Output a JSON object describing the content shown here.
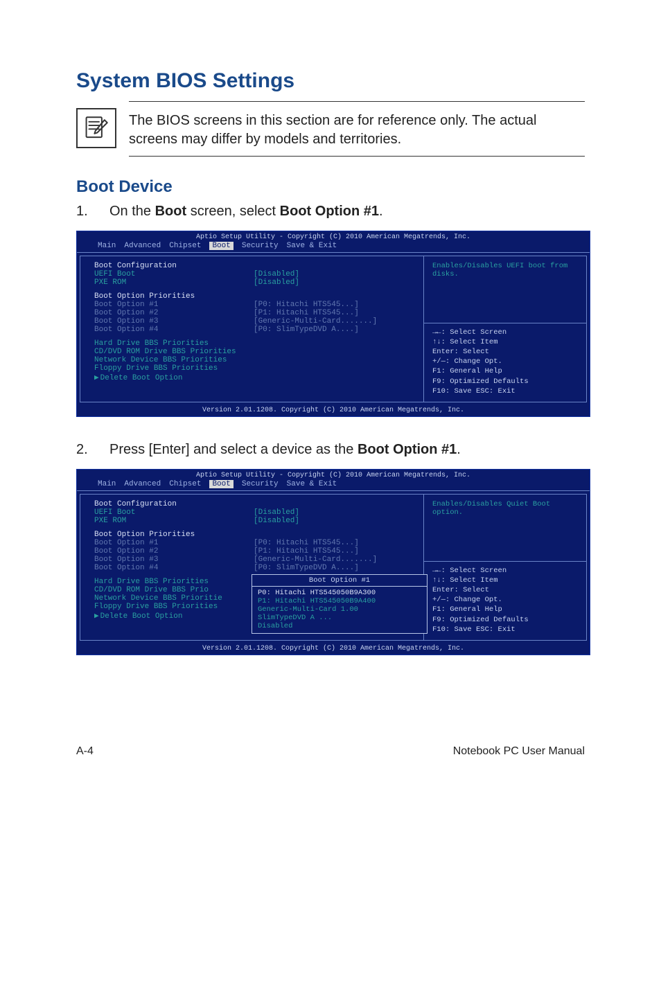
{
  "section_title": "System BIOS Settings",
  "note_text": "The BIOS screens in this section are for reference only. The actual screens may differ by models and territories.",
  "subsection_title": "Boot Device",
  "step1": {
    "num": "1.",
    "pre": "On the ",
    "b1": "Boot",
    "mid": " screen, select ",
    "b2": "Boot Option #1",
    "post": "."
  },
  "step2": {
    "num": "2.",
    "pre": "Press [Enter] and select a device as the ",
    "b1": "Boot Option #1",
    "post": "."
  },
  "bios_common": {
    "top": "Aptio Setup Utility - Copyright (C) 2010 American Megatrends, Inc.",
    "tabs": [
      "Main",
      "Advanced",
      "Chipset",
      "Boot",
      "Security",
      "Save & Exit"
    ],
    "footer": "Version 2.01.1208. Copyright (C) 2010 American Megatrends, Inc.",
    "keys": [
      "→←: Select Screen",
      "↑↓:   Select Item",
      "Enter: Select",
      "+/—:  Change Opt.",
      "F1:    General Help",
      "F9:    Optimized Defaults",
      "F10:  Save    ESC: Exit"
    ]
  },
  "bios1": {
    "help": "Enables/Disables UEFI boot from disks.",
    "boot_config_hdr": "Boot Configuration",
    "uefi_label": "UEFI Boot",
    "uefi_val": "[Disabled]",
    "pxe_label": "PXE ROM",
    "pxe_val": "[Disabled]",
    "prio_hdr": "Boot Option Priorities",
    "opts": [
      {
        "l": "Boot Option #1",
        "r": "[P0:  Hitachi HTS545...]"
      },
      {
        "l": "Boot Option #2",
        "r": "[P1:  Hitachi HTS545...]"
      },
      {
        "l": "Boot Option #3",
        "r": "[Generic-Multi-Card.......]"
      },
      {
        "l": "Boot Option #4",
        "r": "[P0:  SlimTypeDVD A....]"
      }
    ],
    "links": [
      "Hard Drive BBS Priorities",
      "CD/DVD ROM Drive BBS Priorities",
      "Network Device BBS Priorities",
      "Floppy Drive BBS Priorities",
      "Delete Boot Option"
    ]
  },
  "bios2": {
    "help": "Enables/Disables Quiet Boot option.",
    "boot_config_hdr": "Boot Configuration",
    "uefi_label": "UEFI Boot",
    "uefi_val": "[Disabled]",
    "pxe_label": "PXE ROM",
    "pxe_val": "[Disabled]",
    "prio_hdr": "Boot Option Priorities",
    "opts": [
      {
        "l": "Boot Option #1",
        "r": "[P0:  Hitachi HTS545...]"
      },
      {
        "l": "Boot Option #2",
        "r": "[P1:  Hitachi HTS545...]"
      },
      {
        "l": "Boot Option #3",
        "r": "[Generic-Multi-Card.......]"
      },
      {
        "l": "Boot Option #4",
        "r": "[P0:  SlimTypeDVD A....]"
      }
    ],
    "links": [
      "Hard Drive BBS Priorities",
      "CD/DVD ROM Drive BBS Prio",
      "Network Device BBS Prioritie",
      "Floppy Drive BBS Priorities",
      "Delete Boot Option"
    ],
    "popup": {
      "title": "Boot Option #1",
      "items": [
        "P0:  Hitachi HTS545050B9A300",
        "P1:  Hitachi HTS545050B9A400",
        "Generic-Multi-Card 1.00",
        "SlimTypeDVD A ...",
        "Disabled"
      ]
    }
  },
  "footer": {
    "left": "A-4",
    "right": "Notebook PC User Manual"
  }
}
